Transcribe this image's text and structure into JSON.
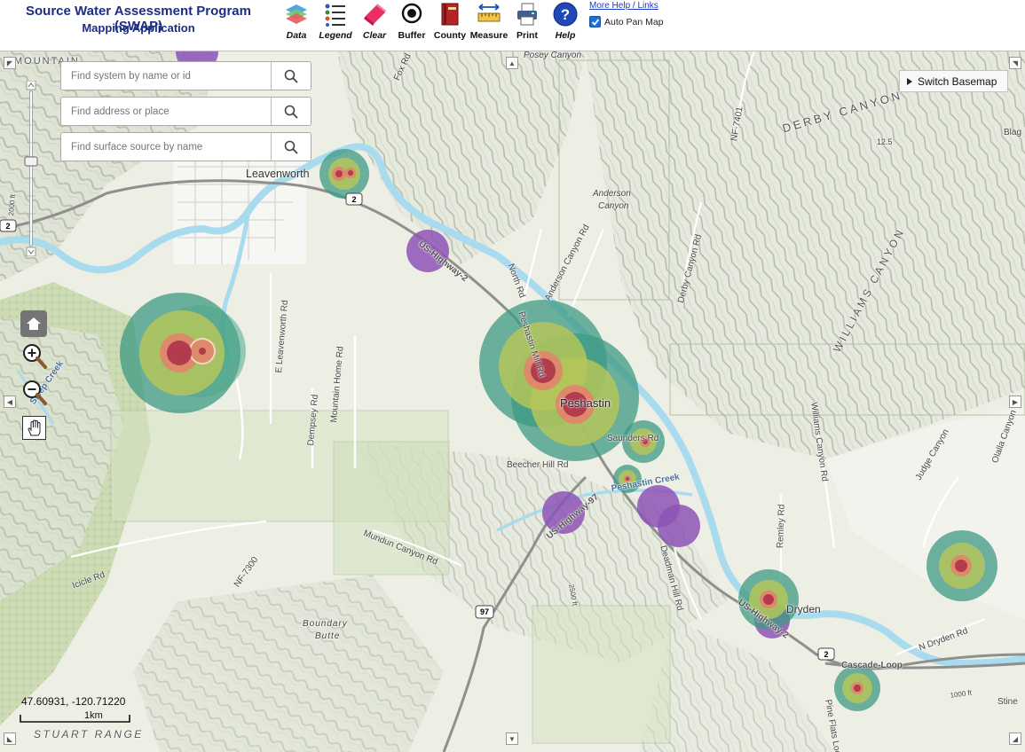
{
  "header": {
    "title": "Source Water Assessment Program (SWAP)",
    "subtitle": "Mapping Application",
    "tools": [
      {
        "label": "Data"
      },
      {
        "label": "Legend"
      },
      {
        "label": "Clear"
      },
      {
        "label": "Buffer"
      },
      {
        "label": "County"
      },
      {
        "label": "Measure"
      },
      {
        "label": "Print"
      },
      {
        "label": "Help"
      }
    ],
    "help_link": "More Help / Links",
    "autopan_label": "Auto Pan Map"
  },
  "map": {
    "search_system_placeholder": "Find system by name or id",
    "search_address_placeholder": "Find address or place",
    "search_surface_placeholder": "Find surface source by name",
    "basemap_button": "Switch Basemap",
    "coordinates": "47.60931, -120.71220",
    "scale_label": "1km",
    "labels": {
      "leavenworth": "Leavenworth",
      "peshastin": "Peshastin",
      "dryden": "Dryden",
      "mountain": "MOUNTAIN",
      "derby_canyon": "DERBY CANYON",
      "williams_canyon": "WILLIAMS CANYON",
      "stuart_range": "STUART RANGE",
      "posey_canyon": "Posey Canyon",
      "anderson_canyon_a": "Anderson",
      "anderson_canyon_b": "Canyon",
      "boundary_butte_a": "Boundary",
      "boundary_butte_b": "Butte",
      "us_highway_2": "US-Highway-2",
      "us_highway_2b": "US-Highway-2",
      "us_highway_97": "US-Highway-97",
      "peshastin_mill_rd": "Peshastin Mill Rd",
      "peshastin_creek": "Peshastin Creek",
      "beecher_hill_rd": "Beecher Hill Rd",
      "saunders_rd": "Saunders Rd",
      "north_rd": "North Rd",
      "anderson_canyon_rd": "Anderson Canyon Rd",
      "derby_canyon_rd": "Derby Canyon Rd",
      "e_leavenworth_rd": "E Leavenworth Rd",
      "mountain_home_rd": "Mountain Home Rd",
      "dempsey_rd": "Dempsey Rd",
      "mundun_canyon_rd": "Mundun Canyon Rd",
      "icicle_rd": "Icicle Rd",
      "nf_7300": "NF-7300",
      "nf_7401": "NF-7401",
      "deadman_hill_rd": "Deadman Hill Rd",
      "remley_rd": "Remley Rd",
      "williams_canyon_rd": "Williams Canyon Rd",
      "judge_canyon": "Judge Canyon",
      "n_dryden_rd": "N Dryden Rd",
      "cascade_loop": "Cascade-Loop",
      "pine_flats_loop": "Pine Flats Loop",
      "fox_rd": "Fox Rd",
      "olalla_canyon": "Olalla Canyon",
      "stine": "Stine",
      "blag": "Blag",
      "sleep_creek": "Sleep Creek",
      "hwy_2_shield": "2",
      "hwy_2_shield_b": "2",
      "hwy_2_shield_c": "2",
      "hwy_97_shield": "97",
      "contour_2000": "2000 ft",
      "contour_1000": "1000 ft",
      "contour_2500": "2500 ft",
      "contour_125": "12.5"
    }
  },
  "colors": {
    "title": "#1b2d86",
    "buffer_outer": "#3d9a83",
    "buffer_mid": "#b4c65b",
    "buffer_inner": "#dc8a6a",
    "buffer_core": "#b23b4e",
    "purple_source": "#8d54b6",
    "river": "#a9dbef"
  }
}
